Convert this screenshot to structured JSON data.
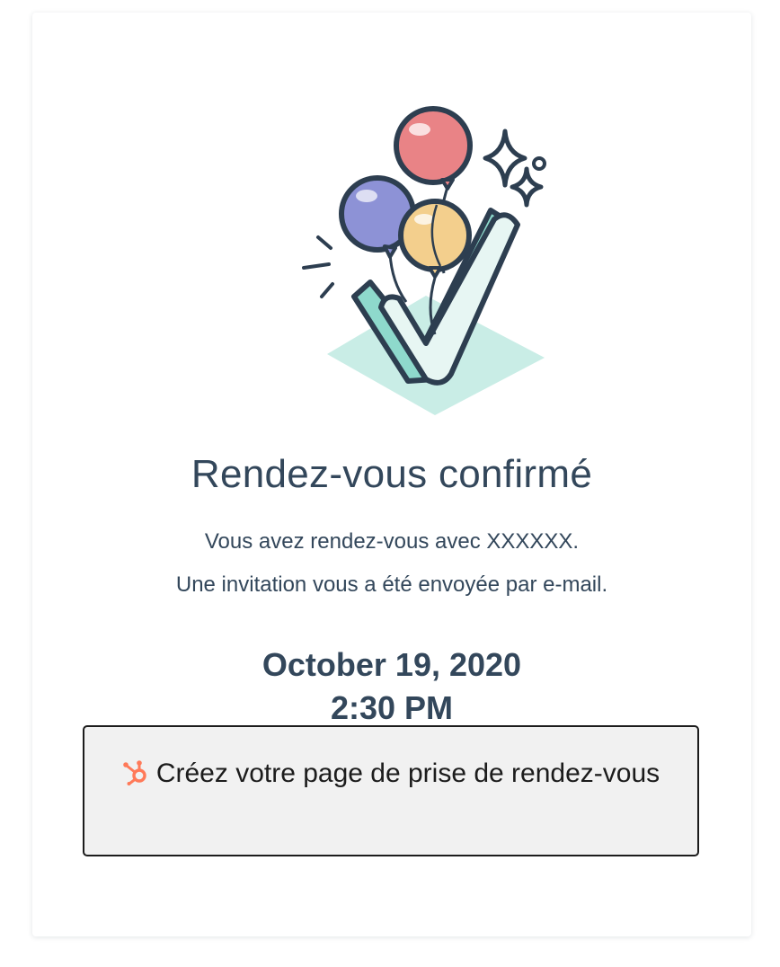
{
  "confirmation": {
    "title": "Rendez-vous confirmé",
    "line1": "Vous avez rendez-vous avec XXXXXX.",
    "line2": "Une invitation vous a été envoyée par e-mail."
  },
  "meeting": {
    "date": "October 19, 2020",
    "time": "2:30 PM"
  },
  "cta": {
    "icon": "hubspot-sprocket-icon",
    "label": "Créez votre page de prise de rendez-vous"
  },
  "illustration": {
    "name": "balloons-checkmark-illustration"
  },
  "colors": {
    "text": "#33475b",
    "accent_orange": "#ff7a59",
    "teal_light": "#c9ede6",
    "teal": "#8ed9cc",
    "balloon_red": "#e98386",
    "balloon_purple": "#8d92d6",
    "balloon_yellow": "#f3cf8d",
    "button_bg": "#f1f1f1"
  }
}
